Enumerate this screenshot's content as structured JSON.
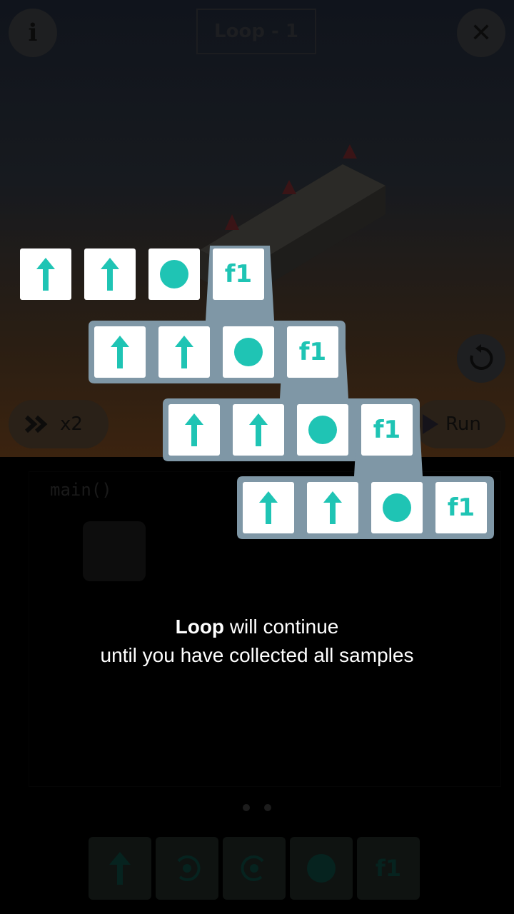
{
  "header": {
    "title": "Loop - 1",
    "info_glyph": "i",
    "close_glyph": "✕"
  },
  "controls": {
    "speed_label": "x2",
    "run_label": "Run"
  },
  "code": {
    "main_label": "main()"
  },
  "loop_rows": [
    [
      "forward",
      "forward",
      "action",
      "f1"
    ],
    [
      "forward",
      "forward",
      "action",
      "f1"
    ],
    [
      "forward",
      "forward",
      "action",
      "f1"
    ],
    [
      "forward",
      "forward",
      "action",
      "f1"
    ]
  ],
  "function_label": "f1",
  "caption": {
    "bold": "Loop",
    "line1_rest": " will continue",
    "line2": "until you have collected all samples"
  },
  "pager": {
    "pages": 2,
    "current": 1
  },
  "palette": [
    "forward-icon",
    "turn-left-icon",
    "turn-right-icon",
    "action-icon",
    "f1"
  ],
  "colors": {
    "accent": "#1fc4b4",
    "bracket": "#7f97a6",
    "tile": "#ffffff"
  }
}
